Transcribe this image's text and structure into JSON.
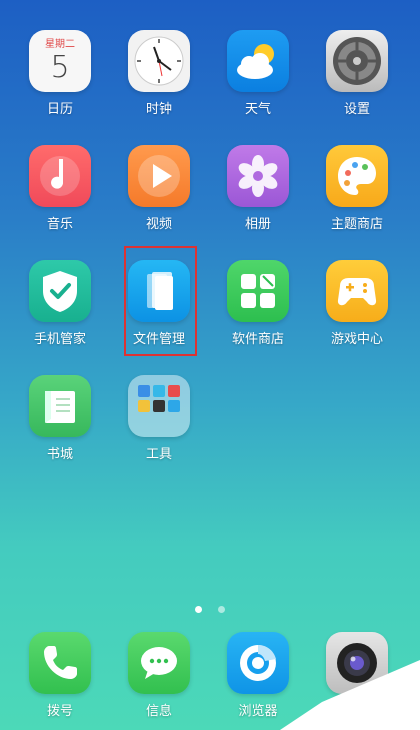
{
  "calendar": {
    "weekday": "星期二",
    "day": "5",
    "label": "日历"
  },
  "apps_row1": [
    {
      "label": "时钟",
      "icon": "clock-icon"
    },
    {
      "label": "天气",
      "icon": "weather-icon"
    },
    {
      "label": "设置",
      "icon": "settings-icon"
    }
  ],
  "apps_row2": [
    {
      "label": "音乐",
      "icon": "music-icon"
    },
    {
      "label": "视频",
      "icon": "video-icon"
    },
    {
      "label": "相册",
      "icon": "album-icon"
    },
    {
      "label": "主题商店",
      "icon": "theme-store-icon"
    }
  ],
  "apps_row3": [
    {
      "label": "手机管家",
      "icon": "phone-manager-icon"
    },
    {
      "label": "文件管理",
      "icon": "file-manager-icon"
    },
    {
      "label": "软件商店",
      "icon": "app-store-icon"
    },
    {
      "label": "游戏中心",
      "icon": "game-center-icon"
    }
  ],
  "apps_row4": [
    {
      "label": "书城",
      "icon": "book-city-icon"
    },
    {
      "label": "工具",
      "icon": "tools-folder-icon"
    }
  ],
  "dock": [
    {
      "label": "拨号",
      "icon": "phone-dial-icon"
    },
    {
      "label": "信息",
      "icon": "messages-icon"
    },
    {
      "label": "浏览器",
      "icon": "browser-icon"
    },
    {
      "label": "",
      "icon": "camera-icon"
    }
  ],
  "page_indicator": {
    "pages": 2,
    "current": 1
  },
  "colors": {
    "highlight": "#dd3333"
  }
}
